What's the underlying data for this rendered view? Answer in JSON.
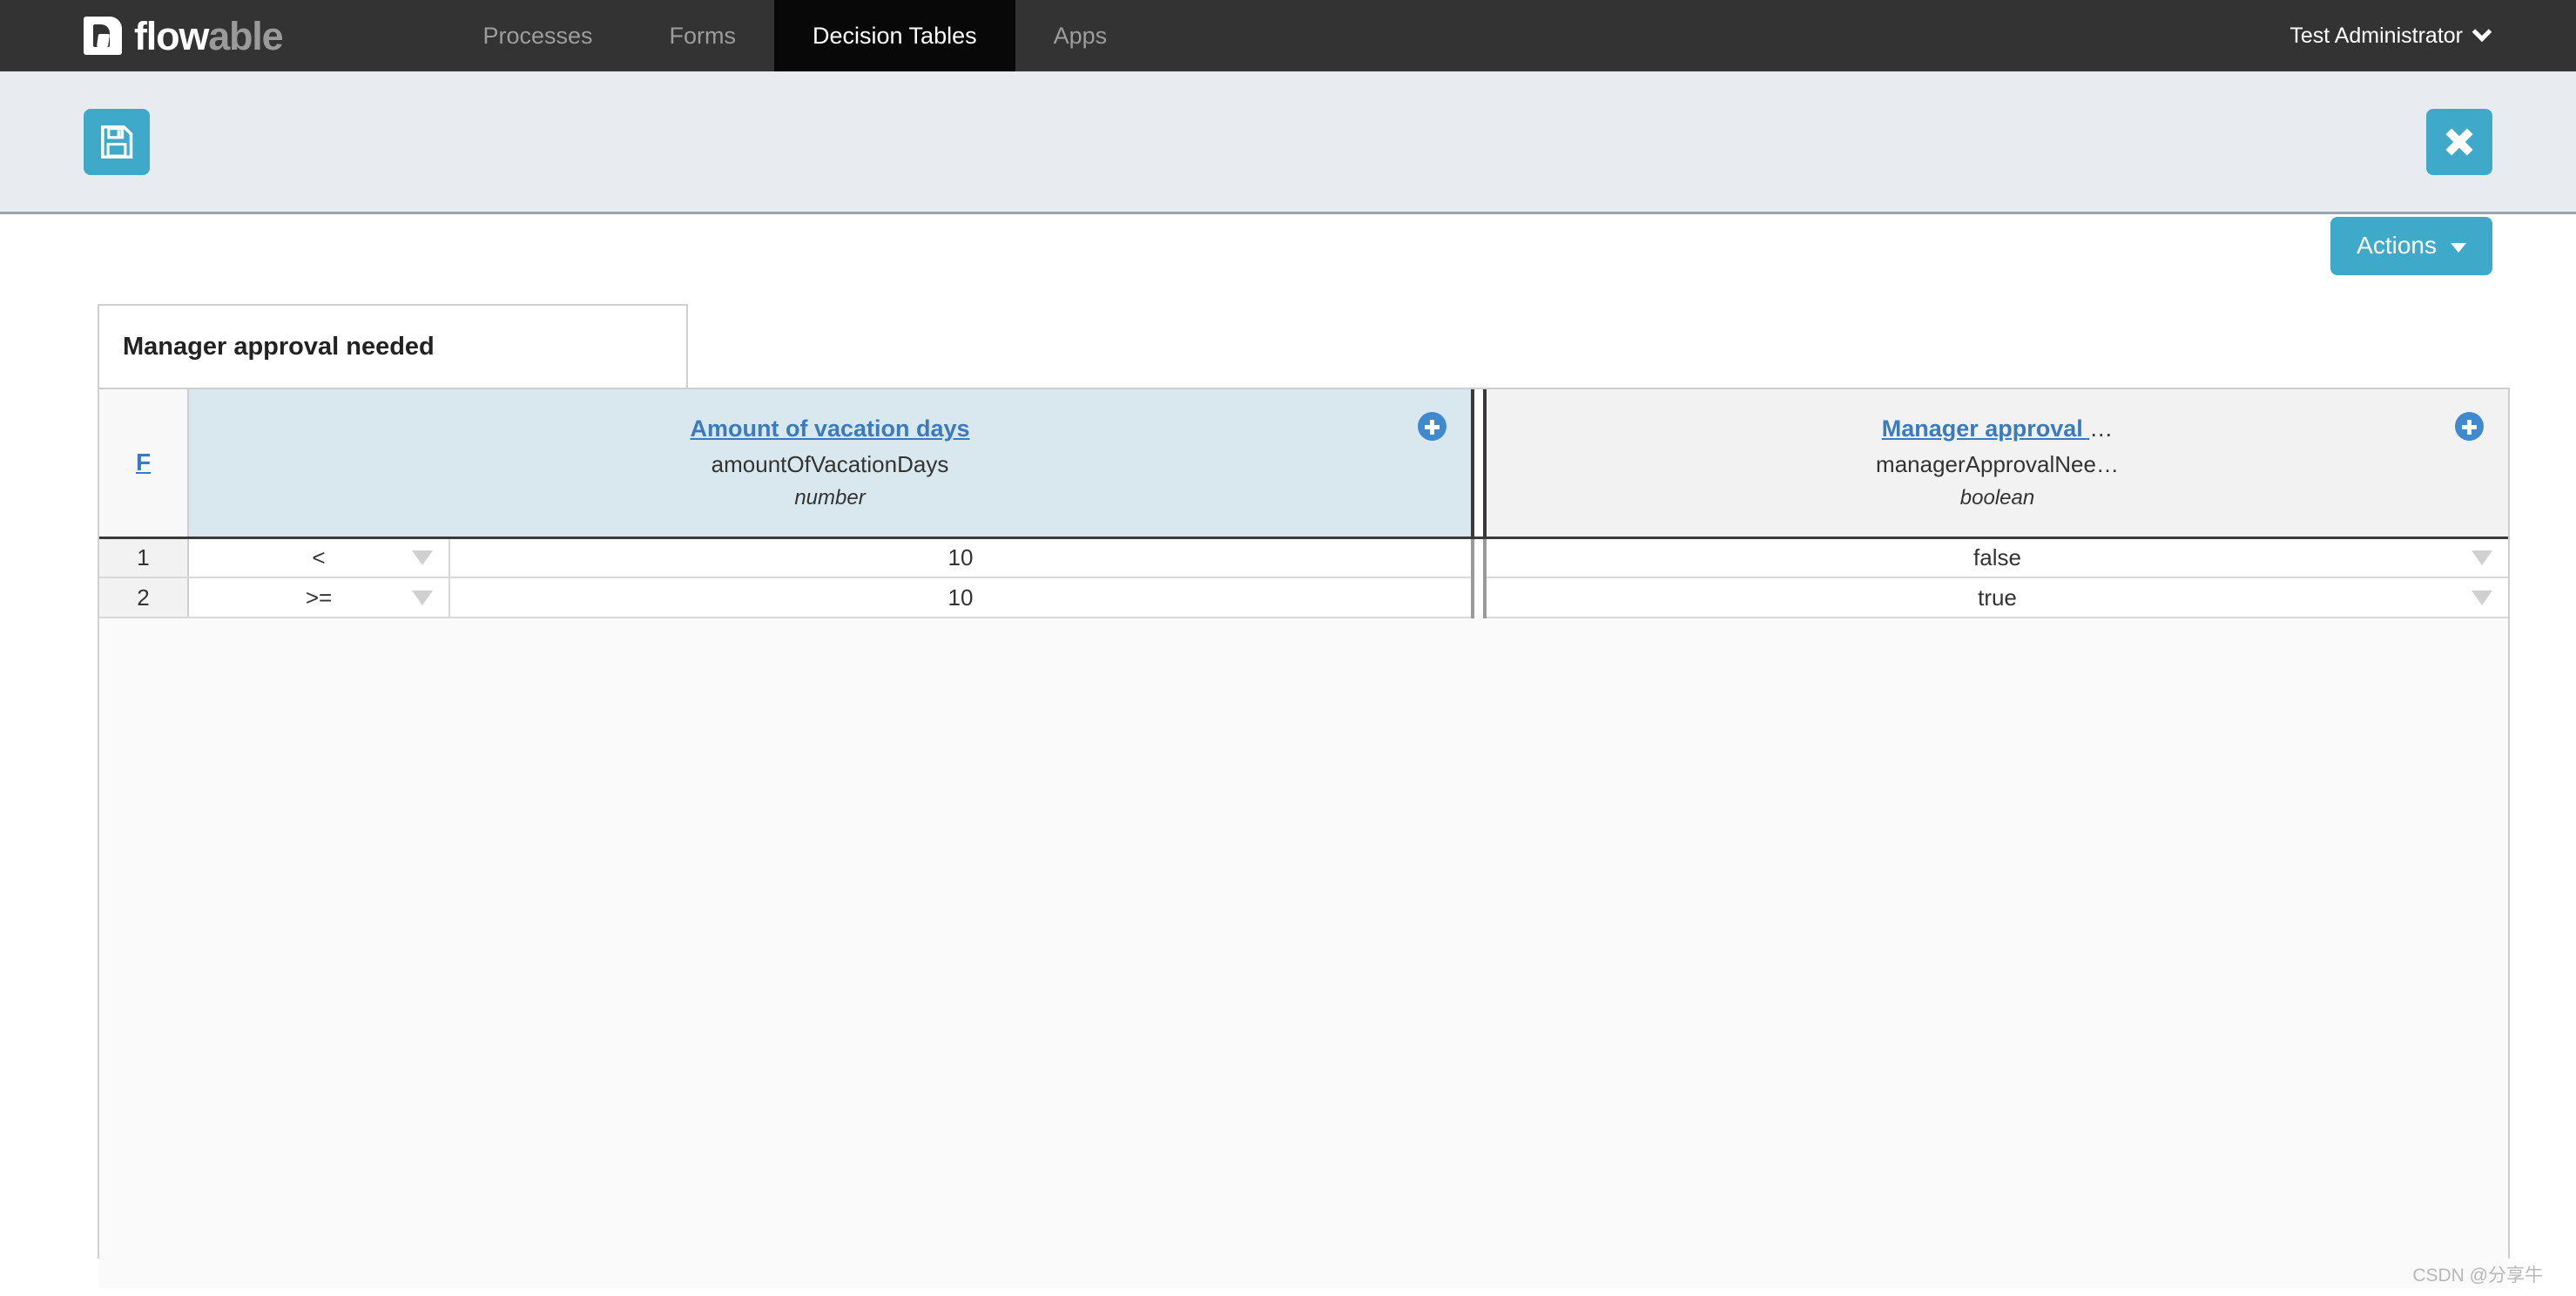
{
  "navbar": {
    "brand": {
      "primary": "flow",
      "secondary": "able",
      "logo_icon": "flowable-logo-icon"
    },
    "tabs": [
      {
        "label": "Processes",
        "active": false
      },
      {
        "label": "Forms",
        "active": false
      },
      {
        "label": "Decision Tables",
        "active": true
      },
      {
        "label": "Apps",
        "active": false
      }
    ],
    "user": {
      "name": "Test Administrator",
      "caret_icon": "chevron-down-icon"
    }
  },
  "toolbar": {
    "save_icon": "save-floppy-icon",
    "close_icon": "close-x-icon",
    "accent_color": "#3fa9c9"
  },
  "content": {
    "actions_button": {
      "label": "Actions",
      "caret_icon": "caret-down-icon"
    }
  },
  "decision_table": {
    "title": "Manager approval needed",
    "hit_policy": "F",
    "add_icon": "plus-circle-icon",
    "dropdown_icon": "caret-down-small-icon",
    "input_columns": [
      {
        "title": "Amount of vacation days",
        "variable": "amountOfVacationDays",
        "type": "number",
        "header_bg": "#d8e8ee"
      }
    ],
    "output_columns": [
      {
        "title": "Manager approval ",
        "title_ellipsis": "…",
        "variable": "managerApprovalNee…",
        "type": "boolean",
        "header_bg": "#f2f2f2"
      }
    ],
    "rows": [
      {
        "number": "1",
        "operator": "<",
        "value": "10",
        "output": "false"
      },
      {
        "number": "2",
        "operator": ">=",
        "value": "10",
        "output": "true"
      }
    ]
  },
  "watermark": "CSDN @分享牛"
}
